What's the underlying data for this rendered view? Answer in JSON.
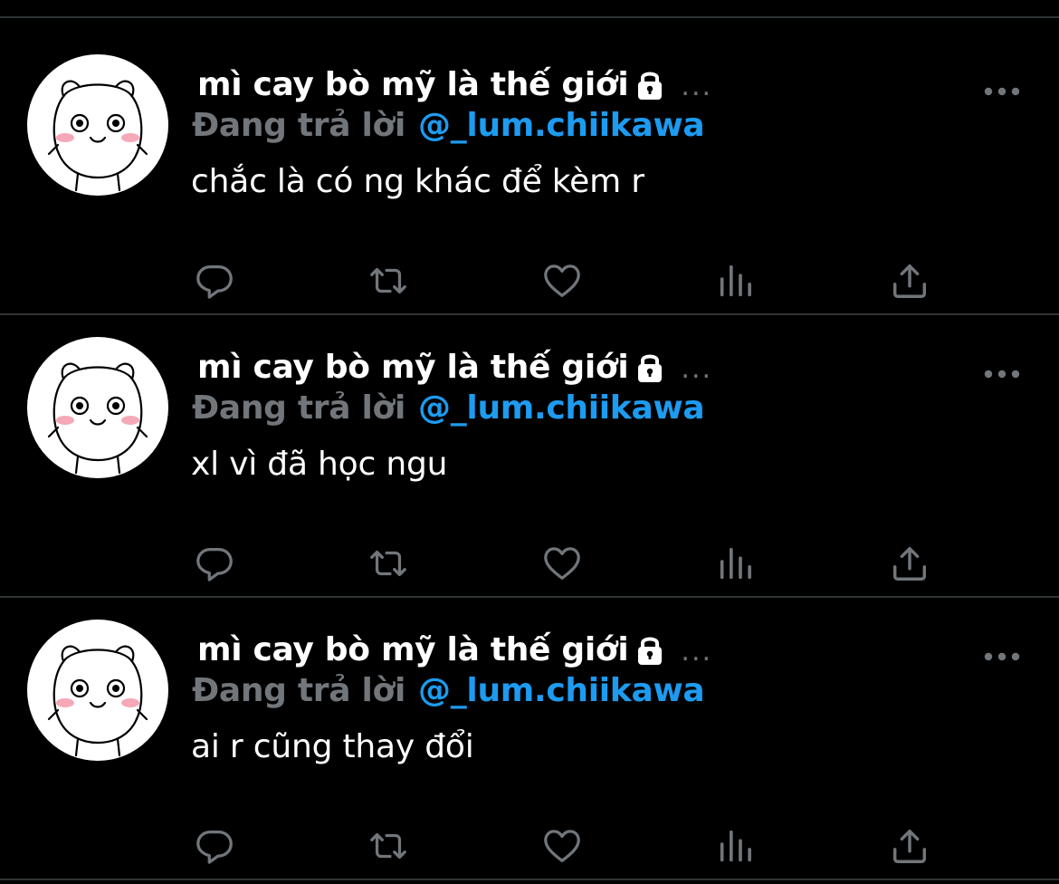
{
  "colors": {
    "background": "#000000",
    "separator": "#2f3336",
    "primary_text": "#ffffff",
    "secondary_text": "#71767b",
    "accent": "#1d9bf0"
  },
  "tweets": [
    {
      "display_name": "mì cay bò mỹ là thế giới",
      "name_truncation": "...",
      "reply_label": "Đang trả lời",
      "reply_handle": "@_lum.chiikawa",
      "text": "chắc là có ng khác để kèm r",
      "icons": {
        "avatar": "chiikawa-avatar",
        "lock": "lock-icon",
        "more": "more-icon",
        "reply": "reply-icon",
        "retweet": "retweet-icon",
        "like": "heart-icon",
        "views": "analytics-icon",
        "share": "share-icon"
      }
    },
    {
      "display_name": "mì cay bò mỹ là thế giới",
      "name_truncation": "...",
      "reply_label": "Đang trả lời",
      "reply_handle": "@_lum.chiikawa",
      "text": "xl vì đã học ngu",
      "icons": {
        "avatar": "chiikawa-avatar",
        "lock": "lock-icon",
        "more": "more-icon",
        "reply": "reply-icon",
        "retweet": "retweet-icon",
        "like": "heart-icon",
        "views": "analytics-icon",
        "share": "share-icon"
      }
    },
    {
      "display_name": "mì cay bò mỹ là thế giới",
      "name_truncation": "...",
      "reply_label": "Đang trả lời",
      "reply_handle": "@_lum.chiikawa",
      "text": "ai r cũng thay đổi",
      "icons": {
        "avatar": "chiikawa-avatar",
        "lock": "lock-icon",
        "more": "more-icon",
        "reply": "reply-icon",
        "retweet": "retweet-icon",
        "like": "heart-icon",
        "views": "analytics-icon",
        "share": "share-icon"
      }
    }
  ]
}
